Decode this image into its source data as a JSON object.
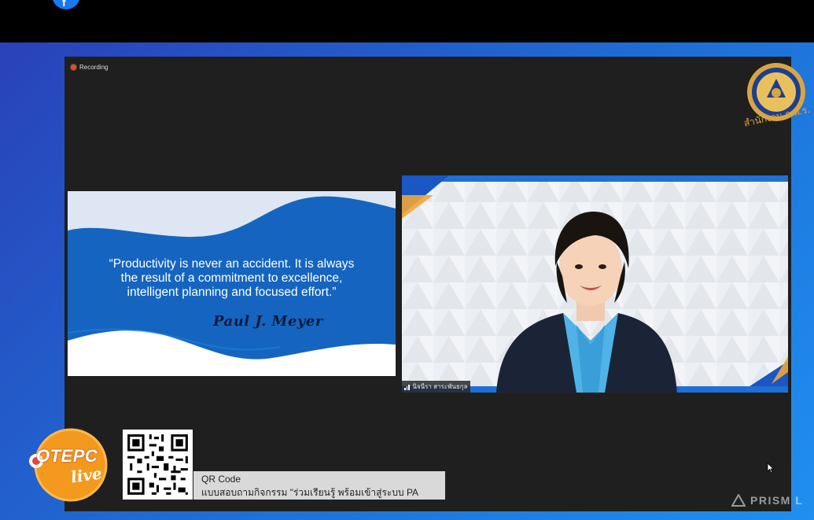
{
  "recording": {
    "label": "Recording"
  },
  "slide": {
    "quote_line1": "“Productivity is never an accident. It is always",
    "quote_line2": "the result of a commitment to excellence,",
    "quote_line3": "intelligent planning and focused effort.”",
    "author": "Paul J. Meyer"
  },
  "participant": {
    "name": "นิจนีรา สาระพันธกุล"
  },
  "qr": {
    "line1": "QR Code",
    "line2": "แบบสอบถามกิจกรรม \"ร่วมเรียนรู้ พร้อมเข้าสู่ระบบ PA"
  },
  "branding": {
    "org_text": "สำนักงาน ก.พ.ร.",
    "otepc": "OTEPC",
    "live": "live",
    "watermark": "PRISM L"
  },
  "colors": {
    "background": "#1e6fd6",
    "slide_blue": "#1565c0",
    "meeting_bg": "#1f1f1f",
    "recording_dot": "#e8453c",
    "logo_gold": "#d9a441",
    "otepc_orange": "#f39a1e"
  },
  "icons": [
    "facebook-icon",
    "recording-dot-icon",
    "signal-icon",
    "qr-code-icon",
    "prism-logo-icon",
    "mouse-cursor-icon",
    "otepc-logo",
    "government-seal-logo"
  ]
}
